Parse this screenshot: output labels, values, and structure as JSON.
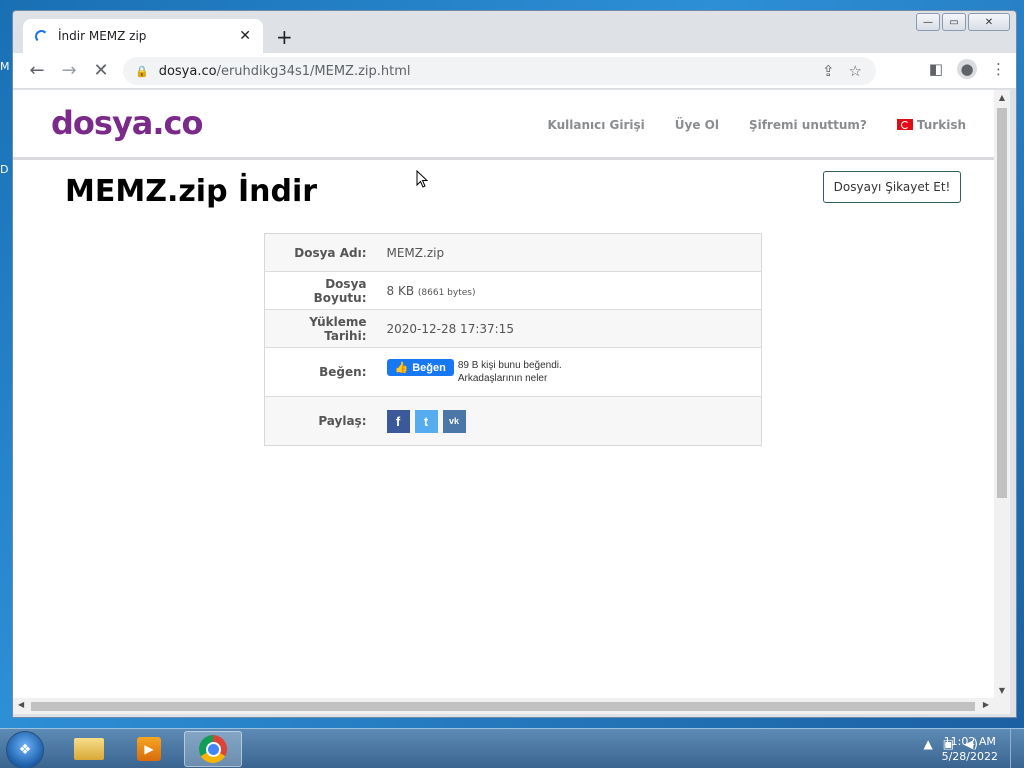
{
  "desktop": {
    "frag1": "M",
    "frag2": "D"
  },
  "window": {
    "caption": {
      "minimize": "—",
      "maximize": "▭",
      "close": "✕"
    }
  },
  "tab": {
    "title": "İndir MEMZ zip",
    "close": "✕",
    "new_tab": "+"
  },
  "toolbar": {
    "back": "←",
    "forward": "→",
    "reload": "✕",
    "url_host": "dosya.co",
    "url_path": "/eruhdikg34s1/MEMZ.zip.html",
    "share_icon": "⇪",
    "star_icon": "☆",
    "sidepanel_icon": "◧",
    "menu_icon": "⋮"
  },
  "site": {
    "logo": "dosya.co",
    "nav": {
      "login": "Kullanıcı Girişi",
      "register": "Üye Ol",
      "forgot": "Şifremi unuttum?",
      "language": "Turkish"
    },
    "title": "MEMZ.zip İndir",
    "complain": "Dosyayı Şikayet Et!"
  },
  "file_info": {
    "name_label": "Dosya Adı:",
    "name_value": "MEMZ.zip",
    "size_label": "Dosya Boyutu:",
    "size_value": "8 KB",
    "size_bytes": "(8661 bytes)",
    "date_label": "Yükleme Tarihi:",
    "date_value": "2020-12-28 17:37:15",
    "like_label": "Beğen:",
    "like_button": "Beğen",
    "like_text1": "89 B kişi bunu beğendi.",
    "like_text2": "Arkadaşlarının neler",
    "share_label": "Paylaş:",
    "share_fb": "f",
    "share_tw": "t",
    "share_vk": "vk"
  },
  "taskbar": {
    "start_glyph": "❖",
    "clock_time": "11:02 AM",
    "clock_date": "5/28/2022",
    "tray_up": "▲",
    "tray_net": "▣",
    "tray_vol": "◀)"
  }
}
